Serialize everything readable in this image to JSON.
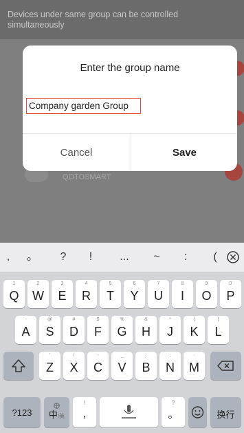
{
  "app": {
    "hint": "Devices under same group can be controlled simultaneously",
    "device_label": "QOTOSMART"
  },
  "dialog": {
    "title": "Enter the group name",
    "input_value": "Company garden Group",
    "cancel": "Cancel",
    "save": "Save"
  },
  "keyboard": {
    "symbols": [
      ",",
      "。",
      "?",
      "!",
      "...",
      "~",
      ":",
      "("
    ],
    "row1": [
      {
        "main": "Q",
        "sub": "1"
      },
      {
        "main": "W",
        "sub": "2"
      },
      {
        "main": "E",
        "sub": "3"
      },
      {
        "main": "R",
        "sub": "4"
      },
      {
        "main": "T",
        "sub": "5"
      },
      {
        "main": "Y",
        "sub": "6"
      },
      {
        "main": "U",
        "sub": "7"
      },
      {
        "main": "I",
        "sub": "8"
      },
      {
        "main": "O",
        "sub": "9"
      },
      {
        "main": "P",
        "sub": "0"
      }
    ],
    "row2": [
      {
        "main": "A",
        "sub": "-"
      },
      {
        "main": "S",
        "sub": "@"
      },
      {
        "main": "D",
        "sub": "#"
      },
      {
        "main": "F",
        "sub": "$"
      },
      {
        "main": "G",
        "sub": "%"
      },
      {
        "main": "H",
        "sub": "&"
      },
      {
        "main": "J",
        "sub": "*"
      },
      {
        "main": "K",
        "sub": "("
      },
      {
        "main": "L",
        "sub": ")"
      }
    ],
    "row3": [
      {
        "main": "Z",
        "sub": "'"
      },
      {
        "main": "X",
        "sub": "/"
      },
      {
        "main": "C",
        "sub": "-"
      },
      {
        "main": "V",
        "sub": "_"
      },
      {
        "main": "B",
        "sub": ":"
      },
      {
        "main": "N",
        "sub": ";"
      },
      {
        "main": "M",
        "sub": "·"
      }
    ],
    "bottom": {
      "num": "?123",
      "lang_main": "中",
      "lang_sub": "/英",
      "comma": ",",
      "comma_sub": "!",
      "period": "。",
      "period_sub": "?",
      "enter": "换行"
    },
    "icons": {
      "shift": "shift-icon",
      "backspace": "backspace-icon",
      "delete": "delete-circle-icon",
      "emoji": "emoji-icon",
      "mic": "microphone-icon",
      "globe": "globe-icon"
    }
  },
  "colors": {
    "input_border": "#e0463a",
    "app_bg": "#7f7f7f",
    "keyboard_bg": "#d2d4d8",
    "fn_key": "#adb3bc",
    "accent_dot": "#a6463f"
  }
}
